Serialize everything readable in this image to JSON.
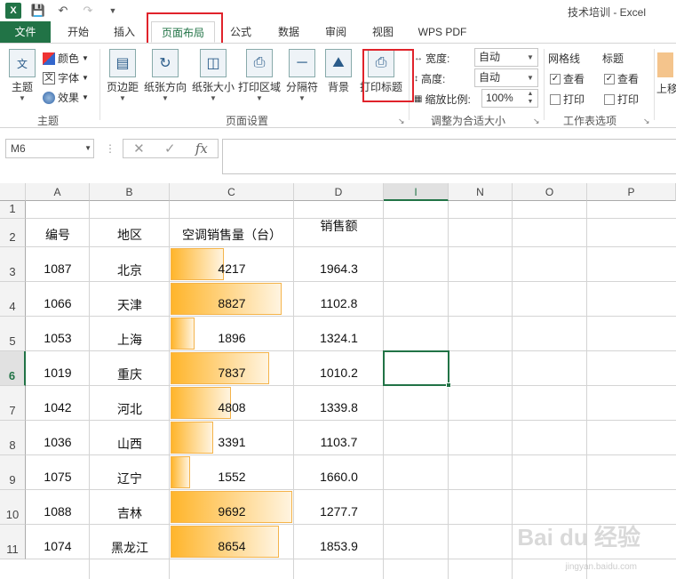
{
  "window": {
    "title": "技术培训 - Excel"
  },
  "tabs": [
    "文件",
    "开始",
    "插入",
    "页面布局",
    "公式",
    "数据",
    "审阅",
    "视图",
    "WPS PDF"
  ],
  "ribbon": {
    "theme_group": {
      "label": "主题",
      "themes_button": "主题",
      "colors": "颜色",
      "fonts": "字体",
      "effects": "效果"
    },
    "page_setup": {
      "label": "页面设置",
      "margins": "页边距",
      "orientation": "纸张方向",
      "size": "纸张大小",
      "print_area": "打印区域",
      "breaks": "分隔符",
      "background": "背景",
      "print_titles": "打印标题"
    },
    "scale_to_fit": {
      "label": "调整为合适大小",
      "width_label": "宽度:",
      "width_value": "自动",
      "height_label": "高度:",
      "height_value": "自动",
      "scale_label": "缩放比例:",
      "scale_value": "100%"
    },
    "sheet_options": {
      "label": "工作表选项",
      "gridlines": "网格线",
      "headings": "标题",
      "view": "查看",
      "print": "打印"
    },
    "arrange_partial": "上移"
  },
  "formula_bar": {
    "name_box": "M6",
    "formula": ""
  },
  "columns": [
    "A",
    "B",
    "C",
    "D",
    "I",
    "N",
    "O",
    "P"
  ],
  "selected_column": "I",
  "selected_row": "6",
  "headers": {
    "id": "编号",
    "region": "地区",
    "ac_sales": "空调销售量（台）",
    "revenue": "销售额"
  },
  "rows": [
    {
      "row": "3",
      "id": "1087",
      "region": "北京",
      "units": 4217,
      "revenue": "1964.3"
    },
    {
      "row": "4",
      "id": "1066",
      "region": "天津",
      "units": 8827,
      "revenue": "1102.8"
    },
    {
      "row": "5",
      "id": "1053",
      "region": "上海",
      "units": 1896,
      "revenue": "1324.1"
    },
    {
      "row": "6",
      "id": "1019",
      "region": "重庆",
      "units": 7837,
      "revenue": "1010.2"
    },
    {
      "row": "7",
      "id": "1042",
      "region": "河北",
      "units": 4808,
      "revenue": "1339.8"
    },
    {
      "row": "8",
      "id": "1036",
      "region": "山西",
      "units": 3391,
      "revenue": "1103.7"
    },
    {
      "row": "9",
      "id": "1075",
      "region": "辽宁",
      "units": 1552,
      "revenue": "1660.0"
    },
    {
      "row": "10",
      "id": "1088",
      "region": "吉林",
      "units": 9692,
      "revenue": "1277.7"
    },
    {
      "row": "11",
      "id": "1074",
      "region": "黑龙江",
      "units": 8654,
      "revenue": "1853.9"
    }
  ],
  "data_bar_max": 9692,
  "watermark": {
    "main": "Bai du 经验",
    "sub": "jingyan.baidu.com"
  },
  "colors": {
    "excel_green": "#217346",
    "highlight_red": "#e0232b",
    "bar_orange": "#ffb52b"
  }
}
